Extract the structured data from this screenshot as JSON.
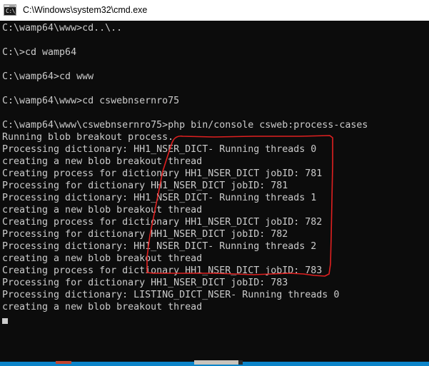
{
  "window": {
    "title": "C:\\Windows\\system32\\cmd.exe",
    "icon": "cmd-console-icon",
    "icon_glyph": "C:\\_",
    "titlebar_bg": "#ffffff",
    "titlebar_fg": "#000000",
    "console_bg": "#0c0c0c",
    "console_fg": "#cccccc"
  },
  "console": {
    "lines": [
      "C:\\wamp64\\www>cd..\\..",
      "",
      "C:\\>cd wamp64",
      "",
      "C:\\wamp64>cd www",
      "",
      "C:\\wamp64\\www>cd cswebnsernro75",
      "",
      "C:\\wamp64\\www\\cswebnsernro75>php bin/console csweb:process-cases",
      "Running blob breakout process.",
      "Processing dictionary: HH1_NSER_DICT- Running threads 0",
      "creating a new blob breakout thread",
      "Creating process for dictionary HH1_NSER_DICT jobID: 781",
      "Processing for dictionary HH1_NSER_DICT jobID: 781",
      "Processing dictionary: HH1_NSER_DICT- Running threads 1",
      "creating a new blob breakout thread",
      "Creating process for dictionary HH1_NSER_DICT jobID: 782",
      "Processing for dictionary HH1_NSER_DICT jobID: 782",
      "Processing dictionary: HH1_NSER_DICT- Running threads 2",
      "creating a new blob breakout thread",
      "Creating process for dictionary HH1_NSER_DICT jobID: 783",
      "Processing for dictionary HH1_NSER_DICT jobID: 783",
      "Processing dictionary: LISTING_DICT_NSER- Running threads 0",
      "creating a new blob breakout thread"
    ],
    "cursor_visible": true
  },
  "annotation": {
    "color": "#e02020",
    "shape": "hand-drawn-rectangle",
    "encloses": "running-threads-and-jobid-output-block"
  },
  "taskbar": {
    "accent_color": "#0b84c9"
  }
}
